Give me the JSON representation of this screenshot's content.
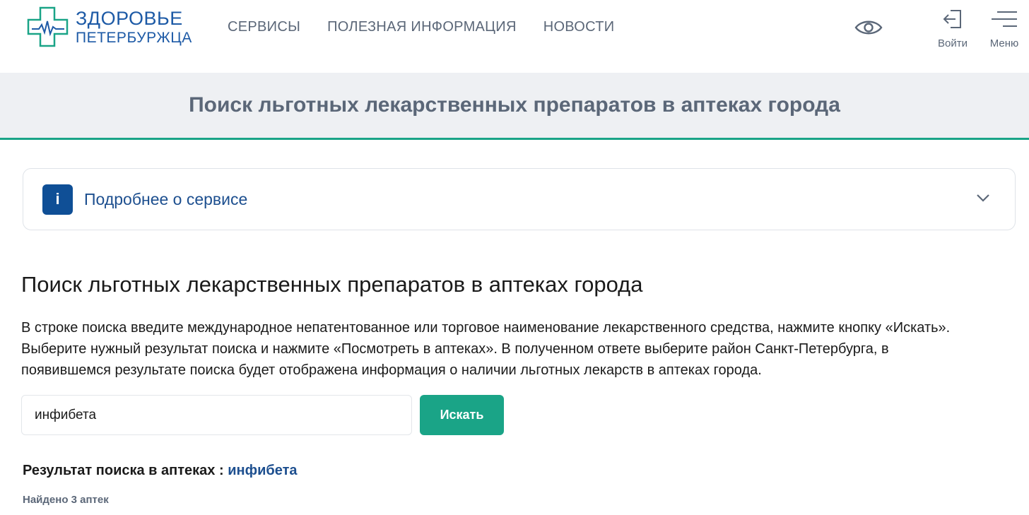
{
  "header": {
    "logo": {
      "line1": "ЗДОРОВЬЕ",
      "line2": "ПЕТЕРБУРЖЦА",
      "icon": "medical-cross-heartbeat-logo",
      "color": "#1d5aa6",
      "accent": "#1aa487"
    },
    "nav": [
      {
        "label": "СЕРВИСЫ"
      },
      {
        "label": "ПОЛЕЗНАЯ ИНФОРМАЦИЯ"
      },
      {
        "label": "НОВОСТИ"
      }
    ],
    "accessibility_icon": "eye-icon",
    "login": {
      "label": "Войти",
      "icon": "login-arrow-icon"
    },
    "menu": {
      "label": "Меню",
      "icon": "hamburger-icon"
    }
  },
  "title_band": {
    "title": "Поиск льготных лекарственных препаратов в аптеках города",
    "bg": "#eef0f3",
    "accent": "#1aa487"
  },
  "info_card": {
    "icon_letter": "i",
    "label": "Подробнее о сервисе",
    "icon": "info-icon",
    "chevron": "chevron-down-icon"
  },
  "main": {
    "title": "Поиск льготных лекарственных препаратов в аптеках города",
    "description_lines": [
      "В строке поиска введите международное непатентованное или торговое наименование лекарственного средства, нажмите кнопку «Искать».",
      "Выберите нужный результат поиска и нажмите «Посмотреть в аптеках». В полученном ответе выберите район Санкт-Петербурга, в",
      "появившемся результате поиска будет отображена информация о наличии льготных лекарств в аптеках города."
    ],
    "search": {
      "value": "инфибета",
      "button_label": "Искать",
      "button_color": "#1aa487"
    },
    "result": {
      "prefix": "Результат поиска в аптеках : ",
      "query": "инфибета"
    },
    "found": "Найдено 3 аптек"
  }
}
